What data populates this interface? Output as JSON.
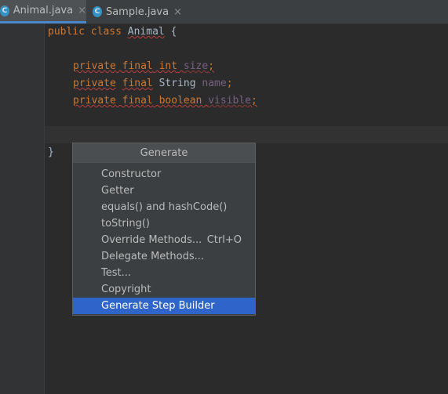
{
  "tabs": [
    {
      "icon": "C",
      "label": "Animal.java",
      "close": "×",
      "active": true
    },
    {
      "icon": "C",
      "label": "Sample.java",
      "close": "×",
      "active": false
    }
  ],
  "code": {
    "line1": {
      "kw1": "public",
      "kw2": "class",
      "name": "Animal",
      "brace": "{"
    },
    "line3": {
      "kw1": "private",
      "kw2": "final",
      "type": "int",
      "field": "size",
      "semi": ";"
    },
    "line4": {
      "kw1": "private",
      "kw2": "final",
      "type": "String",
      "field": "name",
      "semi": ";"
    },
    "line5": {
      "kw1": "private",
      "kw2": "final",
      "type": "boolean",
      "field": "visible",
      "semi": ";"
    },
    "close_brace": "}"
  },
  "popup": {
    "title": "Generate",
    "items": [
      {
        "label": "Constructor"
      },
      {
        "label": "Getter"
      },
      {
        "label": "equals() and hashCode()"
      },
      {
        "label": "toString()"
      },
      {
        "label": "Override Methods...",
        "shortcut": "Ctrl+O"
      },
      {
        "label": "Delegate Methods..."
      },
      {
        "label": "Test..."
      },
      {
        "label": "Copyright"
      },
      {
        "label": "Generate Step Builder",
        "selected": true
      }
    ]
  },
  "colors": {
    "keyword": "#cc7832",
    "field": "#9876aa",
    "selection": "#2f65ca",
    "tab_underline": "#4a88c7"
  }
}
